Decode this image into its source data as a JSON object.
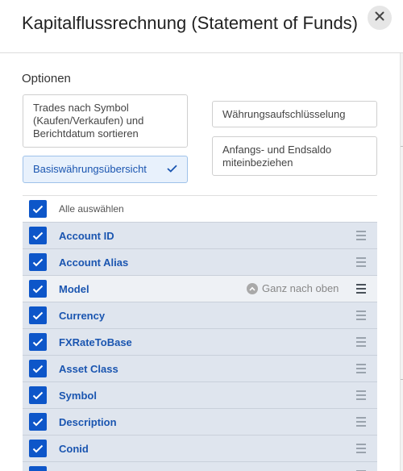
{
  "dialog": {
    "title": "Kapitalflussrechnung (Statement of Funds)"
  },
  "options": {
    "section_label": "Optionen",
    "sort_trades": "Trades nach Symbol (Kaufen/Verkaufen) und Berichtdatum sortieren",
    "base_currency_summary": "Basiswährungsübersicht",
    "currency_breakdown": "Währungsaufschlüsselung",
    "include_balances": "Anfangs- und Endsaldo miteinbeziehen"
  },
  "fields": {
    "select_all_label": "Alle auswählen",
    "move_to_top_label": "Ganz nach oben",
    "items": [
      {
        "label": "Account ID",
        "checked": true
      },
      {
        "label": "Account Alias",
        "checked": true
      },
      {
        "label": "Model",
        "checked": true
      },
      {
        "label": "Currency",
        "checked": true
      },
      {
        "label": "FXRateToBase",
        "checked": true
      },
      {
        "label": "Asset Class",
        "checked": true
      },
      {
        "label": "Symbol",
        "checked": true
      },
      {
        "label": "Description",
        "checked": true
      },
      {
        "label": "Conid",
        "checked": true
      }
    ]
  },
  "colors": {
    "accent": "#0d56c9",
    "selected_background": "#e8f1fc",
    "row_background": "#dfe5ee"
  }
}
